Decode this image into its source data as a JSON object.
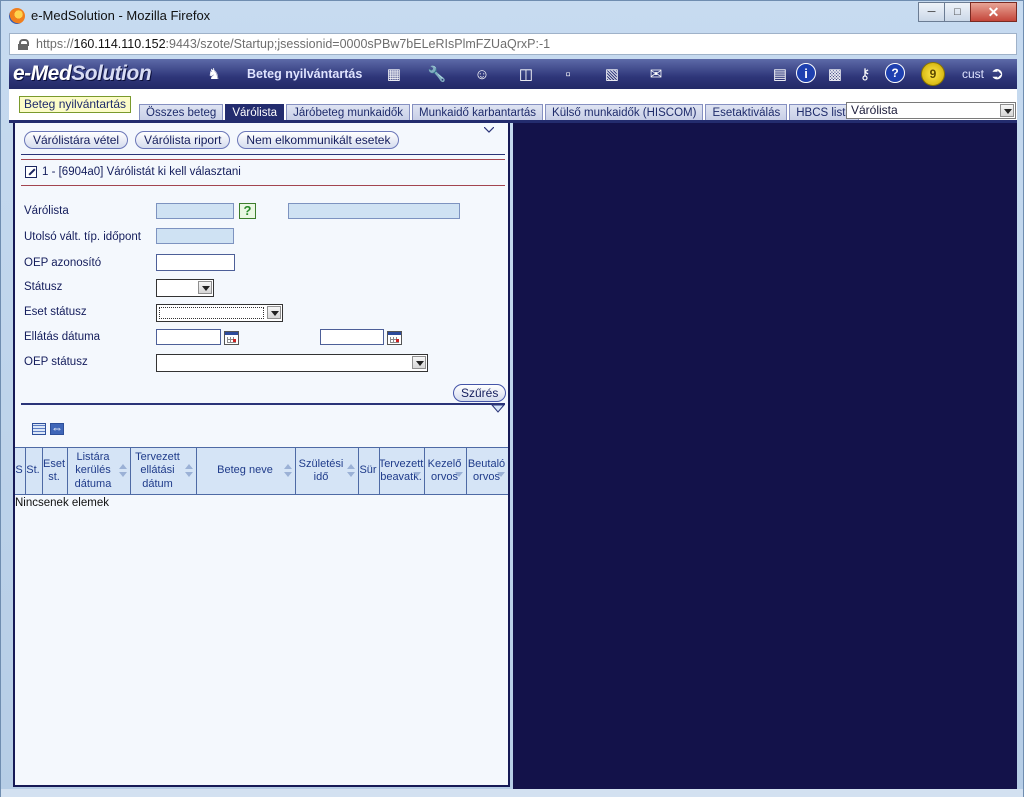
{
  "window": {
    "title": "e-MedSolution - Mozilla Firefox",
    "url_prefix": "https://",
    "url_host": "160.114.110.152",
    "url_rest": ":9443/szote/Startup;jsessionid=0000sPBw7bELeRIsPlmFZUaQrxP:-1"
  },
  "app": {
    "logo_left": "e-Med",
    "logo_right": "Solution",
    "module_name": "Beteg nyilvántartás",
    "user_badge": "9",
    "user_name": "cust",
    "toolbar_icons": [
      "patient-icon",
      "building-icon",
      "wrench-icon",
      "staff-icon",
      "door-icon",
      "pdf-icon",
      "org-chart-icon",
      "mail-icon",
      "document-icon",
      "info-icon",
      "computer-icon",
      "key-icon",
      "help-icon",
      "logout-icon"
    ]
  },
  "tabs": {
    "module_title": "Beteg nyilvántartás",
    "items": [
      "Összes beteg",
      "Várólista",
      "Járóbeteg munkaidők",
      "Munkaidő karbantartás",
      "Külső munkaidők (HISCOM)",
      "Esetaktiválás",
      "HBCS lista"
    ],
    "active": "Várólista",
    "right_select_value": "Várólista"
  },
  "actions": {
    "take_onto_list": "Várólistára vétel",
    "report": "Várólista riport",
    "not_communicated": "Nem elkommunikált esetek"
  },
  "message": "1 - [6904a0] Várólistát ki kell választani",
  "form": {
    "labels": {
      "varolista": "Várólista",
      "last_change": "Utolsó vált. típ. időpont",
      "oep_id": "OEP azonosító",
      "status": "Státusz",
      "case_status": "Eset státusz",
      "care_date": "Ellátás dátuma",
      "oep_status": "OEP státusz"
    },
    "help_symbol": "?",
    "filter_button": "Szűrés"
  },
  "grid": {
    "columns": [
      "S",
      "St.",
      "Eset st.",
      "Listára kerülés dátuma",
      "Tervezett ellátási dátum",
      "Beteg neve",
      "Születési idő",
      "Sür",
      "Tervezett beavatk.",
      "Kezelő orvos",
      "Beutaló orvos"
    ],
    "empty_text": "Nincsenek elemek"
  },
  "colors": {
    "header_dark": "#232c6e",
    "right_panel": "#13124a",
    "readonly_input": "#cfe2f3",
    "grid_header": "#d5e4f6"
  }
}
